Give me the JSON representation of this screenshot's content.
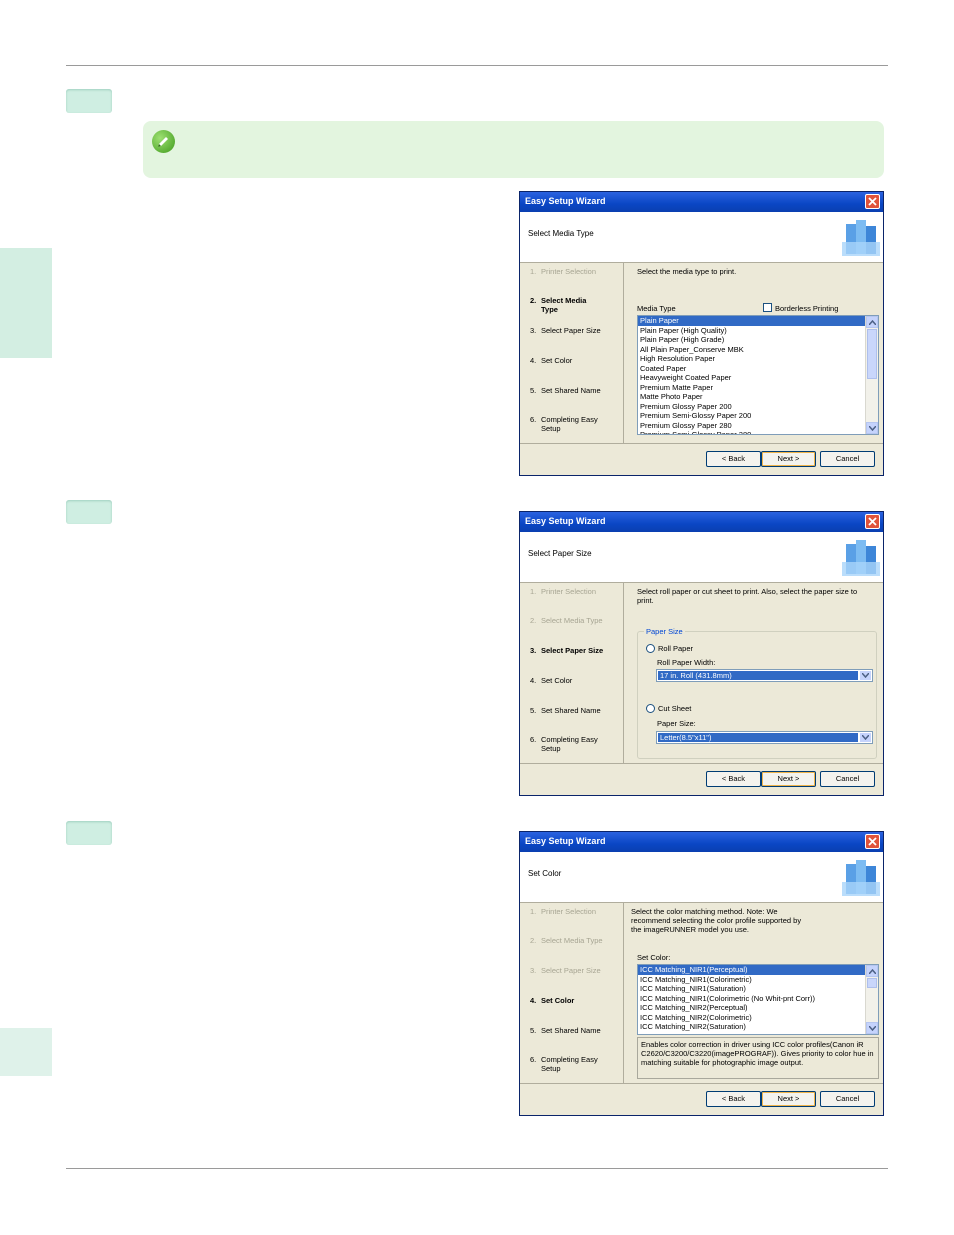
{
  "colors": {
    "note_bg": "#e3f5df",
    "step_tab": "#cfeee2",
    "titlebar": "#0a46c4",
    "selection": "#316ac5"
  },
  "note": {
    "icon": "pencil-note-icon"
  },
  "dialogs": [
    {
      "title": "Easy Setup Wizard",
      "header": "Select Media Type",
      "steps": [
        {
          "num": "1.",
          "label": "Printer Selection",
          "state": "dim"
        },
        {
          "num": "2.",
          "label": "Select Media Type",
          "state": "active"
        },
        {
          "num": "3.",
          "label": "Select Paper Size",
          "state": "normal"
        },
        {
          "num": "4.",
          "label": "Set Color",
          "state": "normal"
        },
        {
          "num": "5.",
          "label": "Set Shared Name",
          "state": "normal"
        },
        {
          "num": "6.",
          "label": "Completing Easy Setup",
          "state": "normal"
        }
      ],
      "description": "Select the media type to print.",
      "media_type_label": "Media Type",
      "borderless_label": "Borderless Printing",
      "borderless_checked": false,
      "media_items": [
        "Plain Paper",
        "Plain Paper (High Quality)",
        "Plain Paper (High Grade)",
        "All Plain Paper_Conserve MBK",
        "High Resolution Paper",
        "Coated Paper",
        "Heavyweight Coated Paper",
        "Premium Matte Paper",
        "Matte Photo Paper",
        "Premium Glossy Paper 200",
        "Premium Semi-Glossy Paper 200",
        "Premium Glossy Paper 280",
        "Premium Semi-Glossy Paper 280"
      ],
      "selected_index": 0,
      "buttons": {
        "back": "< Back",
        "next": "Next >",
        "cancel": "Cancel"
      }
    },
    {
      "title": "Easy Setup Wizard",
      "header": "Select Paper Size",
      "steps": [
        {
          "num": "1.",
          "label": "Printer Selection",
          "state": "dim"
        },
        {
          "num": "2.",
          "label": "Select Media Type",
          "state": "dim"
        },
        {
          "num": "3.",
          "label": "Select Paper Size",
          "state": "active"
        },
        {
          "num": "4.",
          "label": "Set Color",
          "state": "normal"
        },
        {
          "num": "5.",
          "label": "Set Shared Name",
          "state": "normal"
        },
        {
          "num": "6.",
          "label": "Completing Easy Setup",
          "state": "normal"
        }
      ],
      "description": "Select roll paper or cut sheet to print. Also, select the paper size to print.",
      "group_title": "Paper Size",
      "roll_paper_label": "Roll Paper",
      "roll_width_label": "Roll Paper Width:",
      "roll_width_value": "17 in. Roll (431.8mm)",
      "cut_sheet_label": "Cut Sheet",
      "paper_size_label": "Paper Size:",
      "paper_size_value": "Letter(8.5\"x11\")",
      "buttons": {
        "back": "< Back",
        "next": "Next >",
        "cancel": "Cancel"
      }
    },
    {
      "title": "Easy Setup Wizard",
      "header": "Set Color",
      "steps": [
        {
          "num": "1.",
          "label": "Printer Selection",
          "state": "dim"
        },
        {
          "num": "2.",
          "label": "Select Media Type",
          "state": "dim"
        },
        {
          "num": "3.",
          "label": "Select Paper Size",
          "state": "dim"
        },
        {
          "num": "4.",
          "label": "Set Color",
          "state": "active"
        },
        {
          "num": "5.",
          "label": "Set Shared Name",
          "state": "normal"
        },
        {
          "num": "6.",
          "label": "Completing Easy Setup",
          "state": "normal"
        }
      ],
      "description": "Select the color matching method. Note: We recommend selecting the color profile supported by the imageRUNNER model you use.",
      "set_color_label": "Set Color:",
      "color_items": [
        "ICC Matching_NIR1(Perceptual)",
        "ICC Matching_NIR1(Colorimetric)",
        "ICC Matching_NIR1(Saturation)",
        "ICC Matching_NIR1(Colorimetric (No Whit-pnt Corr))",
        "ICC Matching_NIR2(Perceptual)",
        "ICC Matching_NIR2(Colorimetric)",
        "ICC Matching_NIR2(Saturation)"
      ],
      "selected_index": 0,
      "info_text": "Enables color correction in driver using ICC color profiles(Canon iR C2620/C3200/C3220(imagePROGRAF)). Gives priority to color hue in matching suitable for photographic image output.",
      "buttons": {
        "back": "< Back",
        "next": "Next >",
        "cancel": "Cancel"
      }
    }
  ]
}
